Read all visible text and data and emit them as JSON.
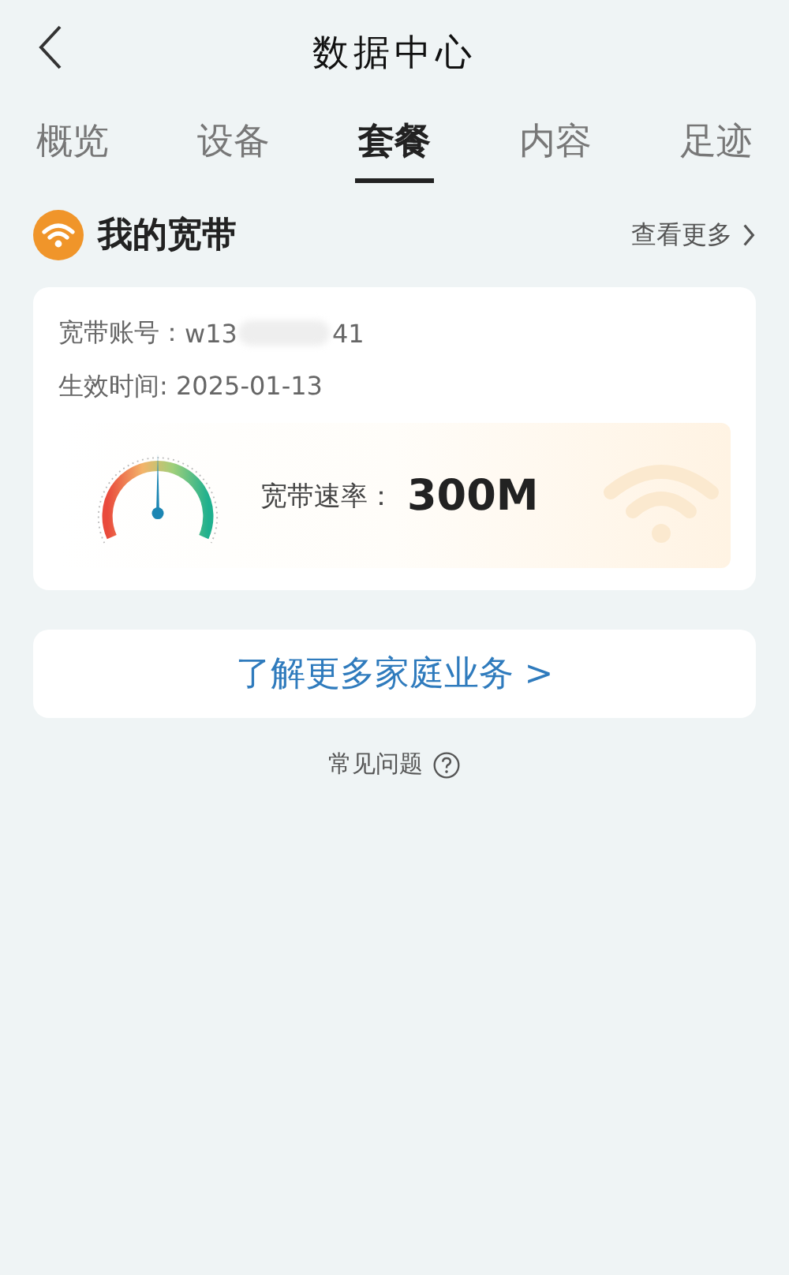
{
  "header": {
    "title": "数据中心"
  },
  "tabs": [
    {
      "label": "概览",
      "selected": false
    },
    {
      "label": "设备",
      "selected": false
    },
    {
      "label": "套餐",
      "selected": true
    },
    {
      "label": "内容",
      "selected": false
    },
    {
      "label": "足迹",
      "selected": false
    }
  ],
  "section": {
    "title": "我的宽带",
    "more": "查看更多"
  },
  "card": {
    "account_label": "宽带账号：",
    "account_value": "w13",
    "account_tail": "41",
    "date": "生效时间: 2025-01-13",
    "speed_label": "宽带速率：",
    "speed_value": "300M"
  },
  "link_button": "了解更多家庭业务 >",
  "faq": "常见问题"
}
